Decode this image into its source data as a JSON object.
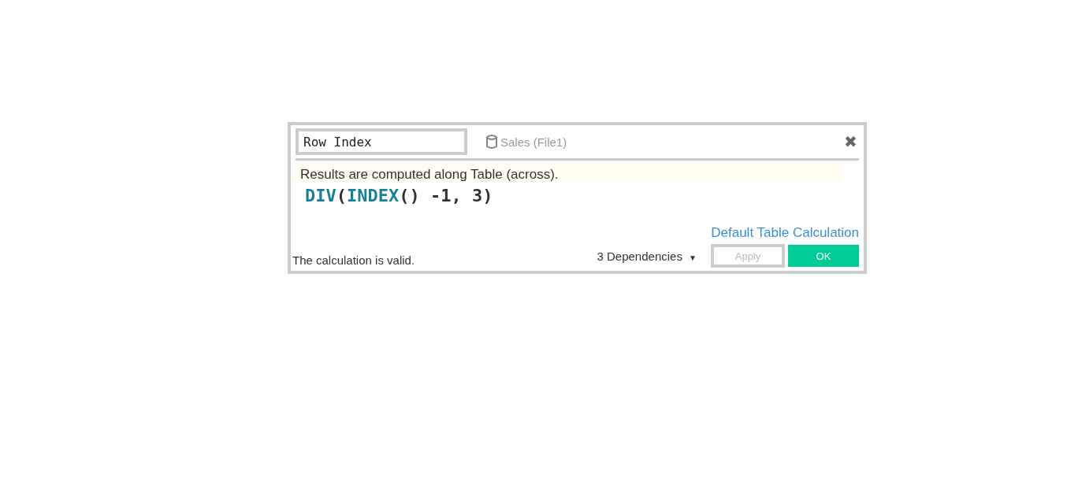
{
  "dialog": {
    "name_field": {
      "value": "Row Index"
    },
    "data_source": "Sales (File1)",
    "close": "✖",
    "info": "Results are computed along Table (across).",
    "formula": [
      {
        "text": "DIV",
        "kind": "function"
      },
      {
        "text": "(",
        "kind": "plain"
      },
      {
        "text": "INDEX",
        "kind": "function"
      },
      {
        "text": "() -1, 3)",
        "kind": "plain"
      }
    ],
    "link": "Default Table Calculation",
    "status": "The calculation is valid.",
    "dependencies": {
      "label": "3 Dependencies",
      "caret": "▼"
    },
    "buttons": [
      {
        "label": "Apply",
        "kind": "secondary",
        "disabled": true
      },
      {
        "label": "OK",
        "kind": "primary",
        "disabled": false
      }
    ]
  }
}
